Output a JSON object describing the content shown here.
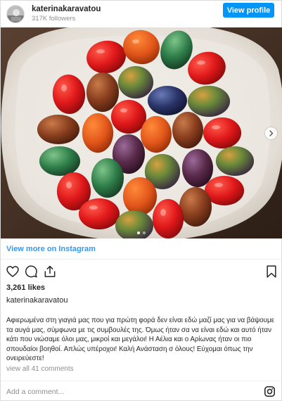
{
  "header": {
    "username": "katerinakaravatou",
    "followers": "317K followers",
    "view_profile_label": "View profile",
    "avatar_icon": "profile-avatar"
  },
  "media": {
    "description_icon": "easter-eggs-photo",
    "next_icon": "chevron-right-icon",
    "carousel_dots": 2,
    "active_dot": 0
  },
  "view_more_label": "View more on Instagram",
  "actions": {
    "like_icon": "heart-icon",
    "comment_icon": "comment-icon",
    "share_icon": "share-icon",
    "save_icon": "bookmark-icon"
  },
  "likes": "3,261 likes",
  "caption": {
    "username": "katerinakaravatou",
    "text": "Αφιερωμένα στη γιαγιά μας που για πρώτη φορά δεν είναι εδώ μαζί μας για να βάψουμε τα αυγά μας, σύμφωνα με τις συμβουλές της. Όμως ήταν σα να είναι εδώ και αυτό ήταν κάτι που νιώσαμε όλοι μας, μικροί και μεγάλοι! Η Αέλια και ο Αρίωνας ήταν οι πιο σπουδαίοι βοηθοί. Απλώς υπέροχοι! Καλή Ανάσταση σ όλους! Εύχομαι όπως την ονειρεύεστε!"
  },
  "view_comments_label": "view all 41 comments",
  "comment_placeholder": "Add a comment...",
  "colors": {
    "accent": "#0095f6",
    "link": "#3897f0",
    "muted": "#8e8e8e",
    "text": "#262626"
  }
}
